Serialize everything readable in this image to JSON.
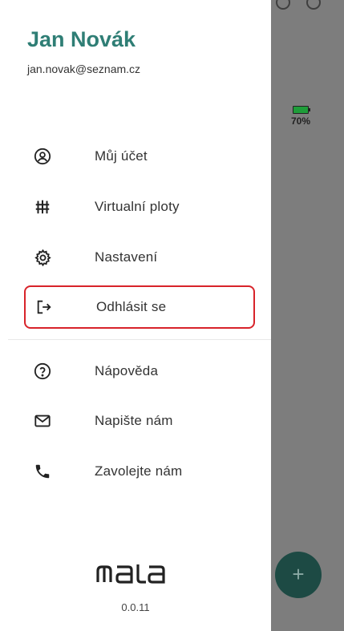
{
  "user": {
    "name": "Jan Novák",
    "email": "jan.novak@seznam.cz"
  },
  "menu": {
    "items": [
      {
        "label": "Můj účet",
        "icon": "account-circle-icon"
      },
      {
        "label": "Virtualní ploty",
        "icon": "fence-icon"
      },
      {
        "label": "Nastavení",
        "icon": "gear-icon"
      },
      {
        "label": "Odhlásit se",
        "icon": "logout-icon",
        "highlighted": true
      },
      {
        "label": "Nápověda",
        "icon": "help-circle-icon"
      },
      {
        "label": "Napište nám",
        "icon": "mail-icon"
      },
      {
        "label": "Zavolejte nám",
        "icon": "phone-icon"
      }
    ]
  },
  "footer": {
    "logo": "mala",
    "version": "0.0.11"
  },
  "background": {
    "battery_percent": "70%",
    "fab_label": "+"
  },
  "colors": {
    "accent": "#2f7e75",
    "highlight_border": "#d8232a",
    "overlay": "#7d7d7d",
    "fab": "#1d4a44"
  }
}
